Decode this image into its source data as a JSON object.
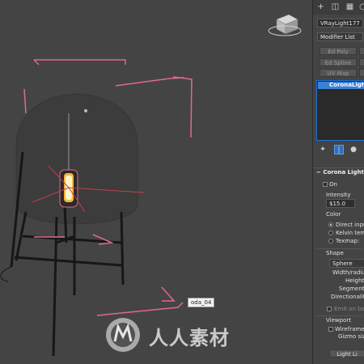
{
  "viewport": {
    "object_tag": "oda_04",
    "watermark_text": "人人素材",
    "accent_light": "#f2b640",
    "gizmo_color": "#e06a8a"
  },
  "panel": {
    "object_name": "VRayLight177",
    "modifier_list_label": "Modifier List",
    "modifier_buttons": [
      "Ed Poly",
      "Ed Spline",
      "UV Map"
    ],
    "stack_item": "CoronaLight",
    "rollout_title": "Corona Light",
    "on_label": "On",
    "intensity_label": "Intensity",
    "intensity_value": "$15.0",
    "color_label": "Color",
    "color_options": [
      "Direct input:",
      "Kelvin temp:",
      "Texmap:"
    ],
    "shape_label": "Shape",
    "shape_value": "Sphere",
    "shape_fields": [
      "Width/radius:",
      "Height:",
      "Segments:",
      "Directionality:"
    ],
    "emit_label": "Emit on both",
    "viewport_label": "Viewport",
    "wireframe_label": "Wireframe",
    "gizmo_label": "Gizmo size:",
    "light_lister_label": "Light Li"
  }
}
